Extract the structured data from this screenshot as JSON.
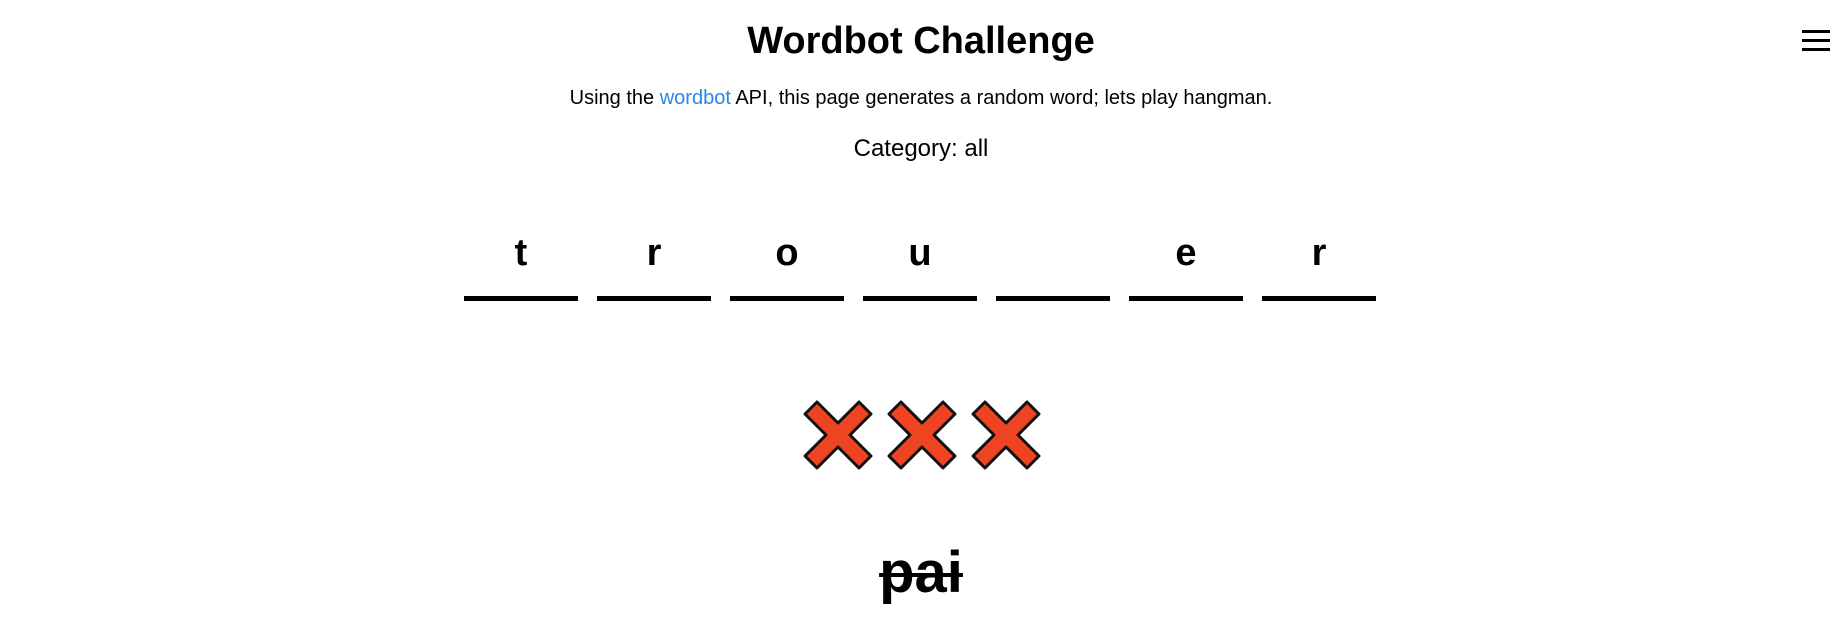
{
  "header": {
    "title": "Wordbot Challenge",
    "menu_icon": "hamburger-menu-icon"
  },
  "intro": {
    "before_link": "Using the ",
    "link_text": "wordbot",
    "after_link": " API, this page generates a random word; lets play hangman.",
    "link_color": "#2a86e8"
  },
  "category": {
    "text": "Category: all"
  },
  "word": {
    "letters": [
      "t",
      "r",
      "o",
      "u",
      "",
      "e",
      "r"
    ]
  },
  "strikes": {
    "count": 3,
    "icon": "red-x-icon",
    "color": "#ee4422"
  },
  "wrong_guesses": {
    "letters": "pai"
  }
}
